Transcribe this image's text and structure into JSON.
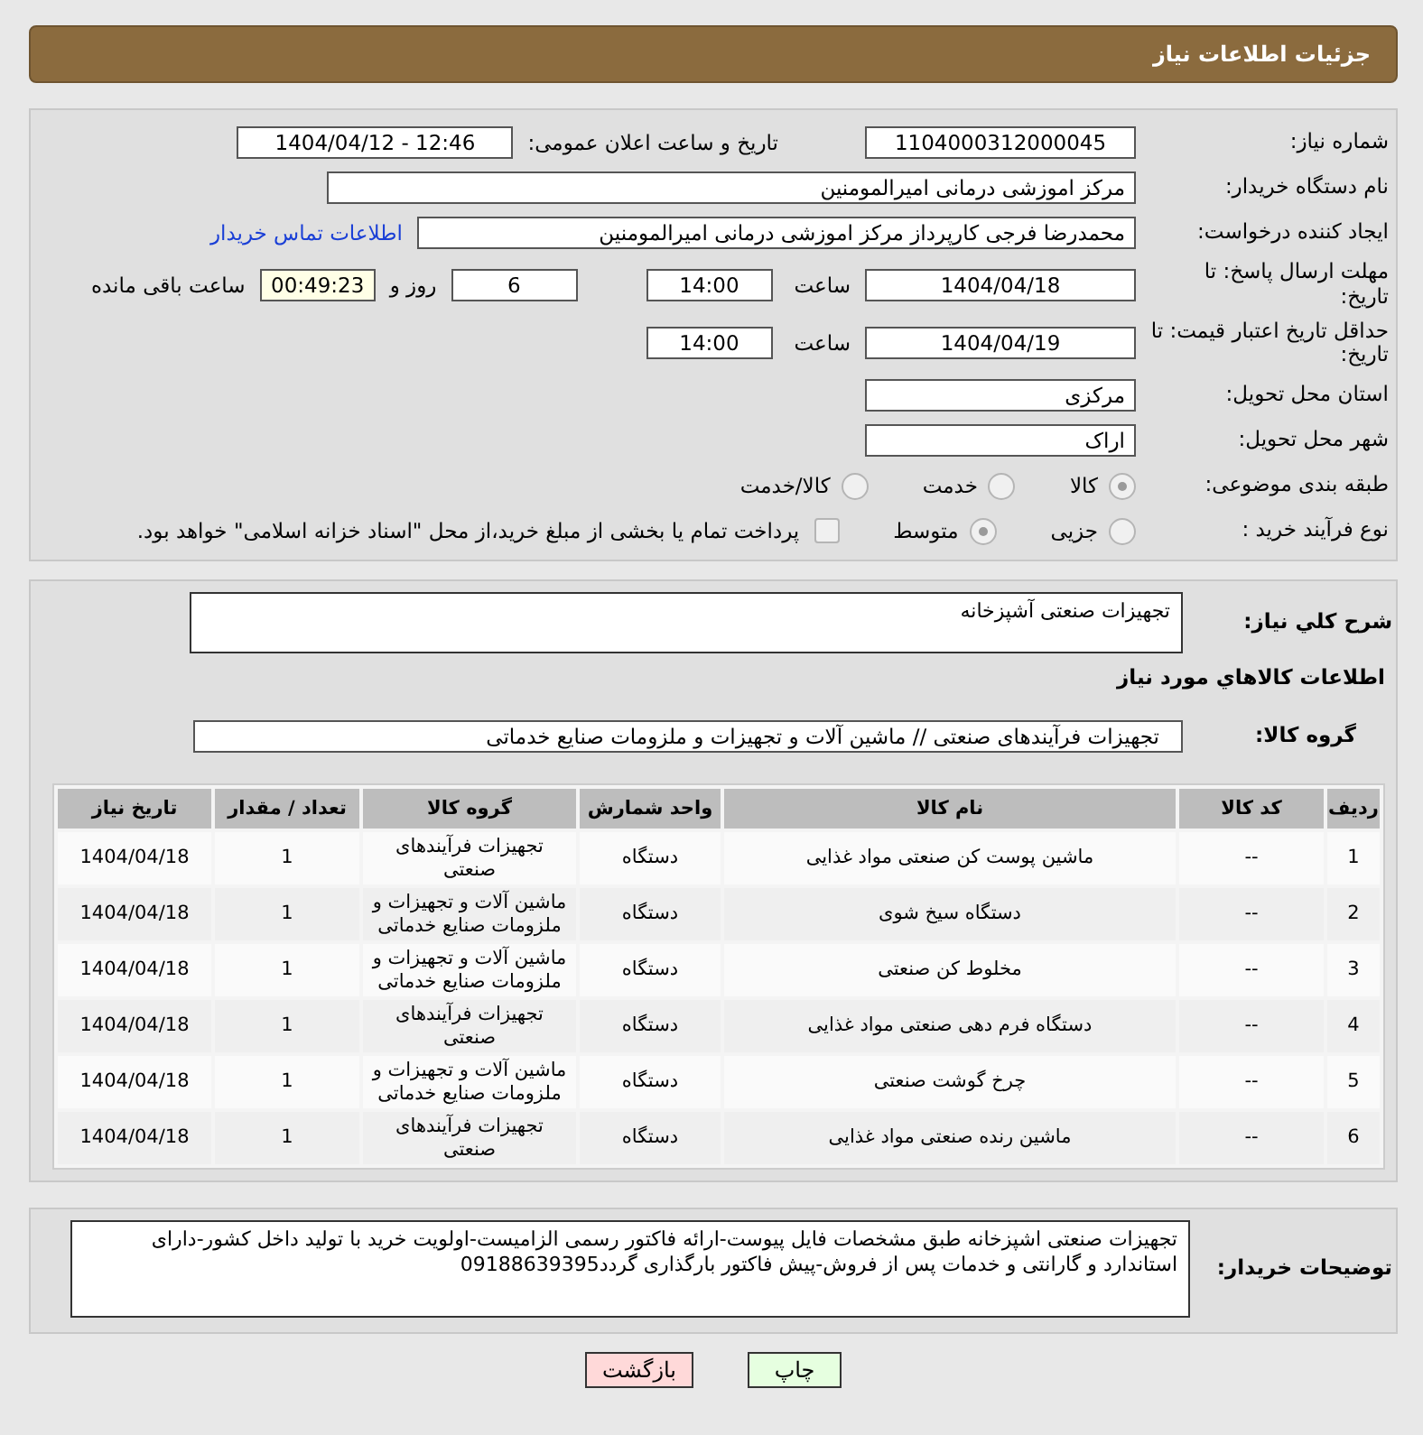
{
  "header": {
    "title": "جزئیات اطلاعات نیاز"
  },
  "need_number": {
    "label": "شماره نیاز:",
    "value": "1104000312000045"
  },
  "announce": {
    "label": "تاریخ و ساعت اعلان عمومی:",
    "value": "1404/04/12 - 12:46"
  },
  "buyer": {
    "label": "نام دستگاه خریدار:",
    "value": "مرکز اموزشی درمانی امیرالمومنین"
  },
  "requester": {
    "label": "ایجاد کننده درخواست:",
    "value": "محمدرضا فرجی کارپرداز مرکز اموزشی درمانی امیرالمومنین",
    "link": "اطلاعات تماس خریدار"
  },
  "deadline": {
    "label": "مهلت ارسال پاسخ: تا تاریخ:",
    "date": "1404/04/18",
    "time_label": "ساعت",
    "time": "14:00",
    "days": "6",
    "days_label": "روز و",
    "remaining": "00:49:23",
    "remaining_label": "ساعت باقی مانده"
  },
  "validity": {
    "label": "حداقل تاریخ اعتبار قیمت: تا تاریخ:",
    "date": "1404/04/19",
    "time_label": "ساعت",
    "time": "14:00"
  },
  "province": {
    "label": "استان محل تحویل:",
    "value": "مرکزی"
  },
  "city": {
    "label": "شهر محل تحویل:",
    "value": "اراک"
  },
  "classification": {
    "label": "طبقه بندی موضوعی:",
    "options": [
      {
        "label": "کالا",
        "selected": true
      },
      {
        "label": "خدمت",
        "selected": false
      },
      {
        "label": "کالا/خدمت",
        "selected": false
      }
    ]
  },
  "process": {
    "label": "نوع فرآیند خرید :",
    "options": [
      {
        "label": "جزیی",
        "selected": false
      },
      {
        "label": "متوسط",
        "selected": true
      }
    ],
    "payment": {
      "label": "پرداخت تمام یا بخشی از مبلغ خرید،از محل \"اسناد خزانه اسلامی\" خواهد بود.",
      "checked": false
    }
  },
  "description": {
    "label": "شرح کلي نياز:",
    "value": "تجهیزات صنعتی آشپزخانه"
  },
  "items_heading": "اطلاعات کالاهاي مورد نياز",
  "goods_group": {
    "label": "گروه کالا:",
    "value": "تجهیزات فرآیندهای صنعتی // ماشین آلات و تجهیزات و ملزومات صنایع خدماتی"
  },
  "table": {
    "columns": [
      "ردیف",
      "کد کالا",
      "نام کالا",
      "واحد شمارش",
      "گروه کالا",
      "تعداد / مقدار",
      "تاریخ نیاز"
    ],
    "rows": [
      [
        "1",
        "--",
        "ماشین پوست کن صنعتی مواد غذایی",
        "دستگاه",
        "تجهیزات فرآیندهای صنعتی",
        "1",
        "1404/04/18"
      ],
      [
        "2",
        "--",
        "دستگاه سیخ شوی",
        "دستگاه",
        "ماشین آلات و تجهیزات و ملزومات صنایع خدماتی",
        "1",
        "1404/04/18"
      ],
      [
        "3",
        "--",
        "مخلوط کن صنعتی",
        "دستگاه",
        "ماشین آلات و تجهیزات و ملزومات صنایع خدماتی",
        "1",
        "1404/04/18"
      ],
      [
        "4",
        "--",
        "دستگاه فرم دهی صنعتی مواد غذایی",
        "دستگاه",
        "تجهیزات فرآیندهای صنعتی",
        "1",
        "1404/04/18"
      ],
      [
        "5",
        "--",
        "چرخ گوشت صنعتی",
        "دستگاه",
        "ماشین آلات و تجهیزات و ملزومات صنایع خدماتی",
        "1",
        "1404/04/18"
      ],
      [
        "6",
        "--",
        "ماشین رنده صنعتی مواد غذایی",
        "دستگاه",
        "تجهیزات فرآیندهای صنعتی",
        "1",
        "1404/04/18"
      ]
    ]
  },
  "notes": {
    "label": "توضیحات خریدار:",
    "value": "تجهیزات صنعتی اشپزخانه طبق مشخصات فایل پیوست-ارائه فاکتور رسمی الزامیست-اولویت خرید با تولید داخل کشور-دارای استاندارد و گارانتی و خدمات پس از فروش-پیش فاکتور بارگذاری گردد09188639395"
  },
  "buttons": [
    {
      "label": "چاپ",
      "kind": "print"
    },
    {
      "label": "بازگشت",
      "kind": "back"
    }
  ]
}
